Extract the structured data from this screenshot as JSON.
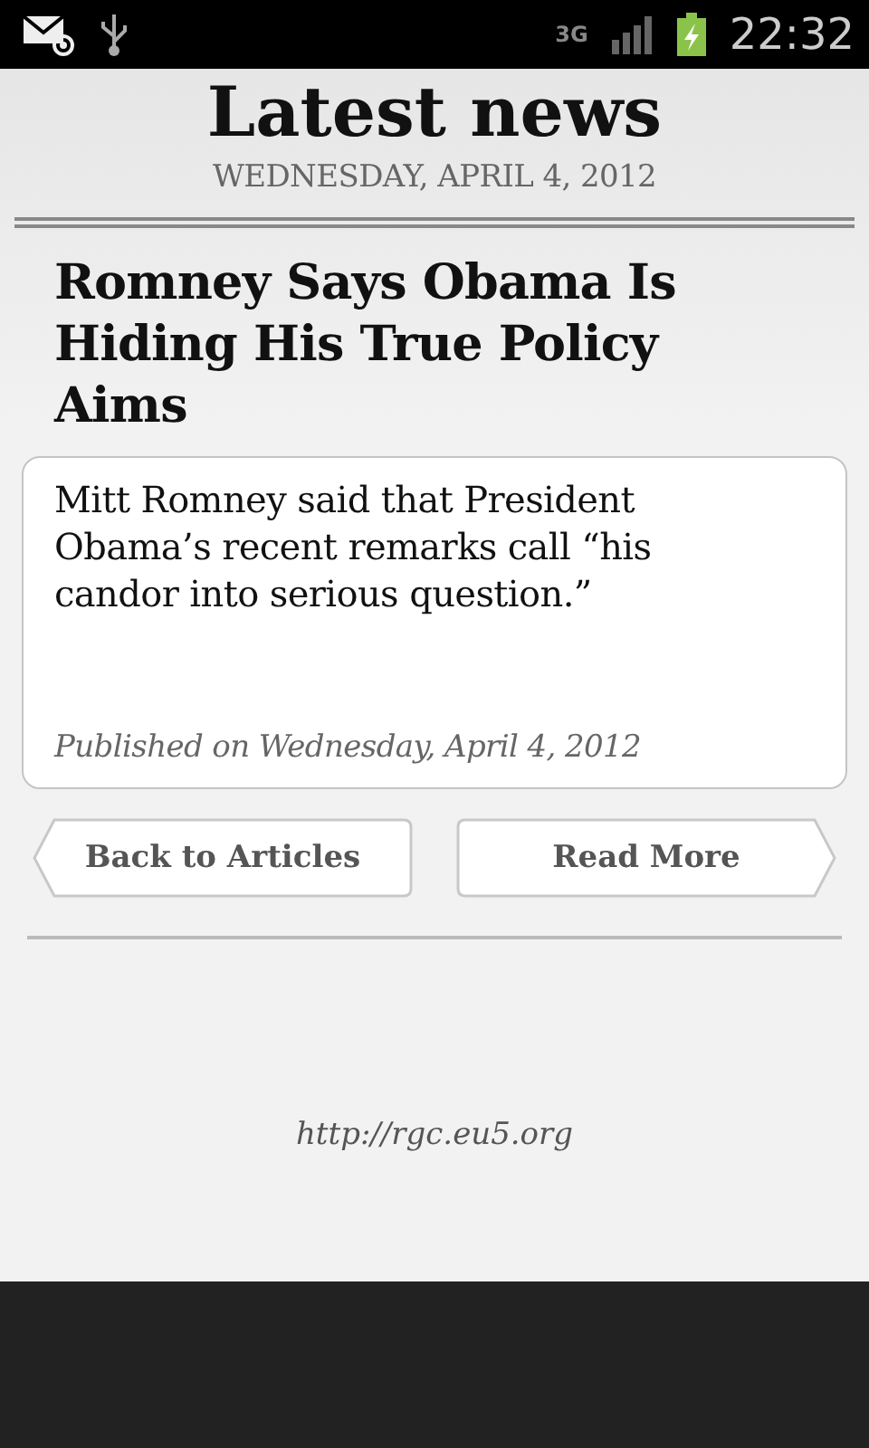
{
  "status_bar": {
    "network": "3G",
    "time": "22:32",
    "battery_charging": true
  },
  "header": {
    "title": "Latest news",
    "date": "WEDNESDAY, APRIL 4, 2012"
  },
  "article": {
    "headline": "Romney Says Obama Is Hiding His True Policy Aims",
    "summary": "Mitt Romney said that President Obama’s recent remarks call “his candor into serious question.”",
    "published": "Published on Wednesday, April 4, 2012"
  },
  "buttons": [
    {
      "label": "Back to Articles",
      "kind": "back"
    },
    {
      "label": "Read More",
      "kind": "forward"
    }
  ],
  "footer": {
    "link": "http://rgc.eu5.org"
  }
}
